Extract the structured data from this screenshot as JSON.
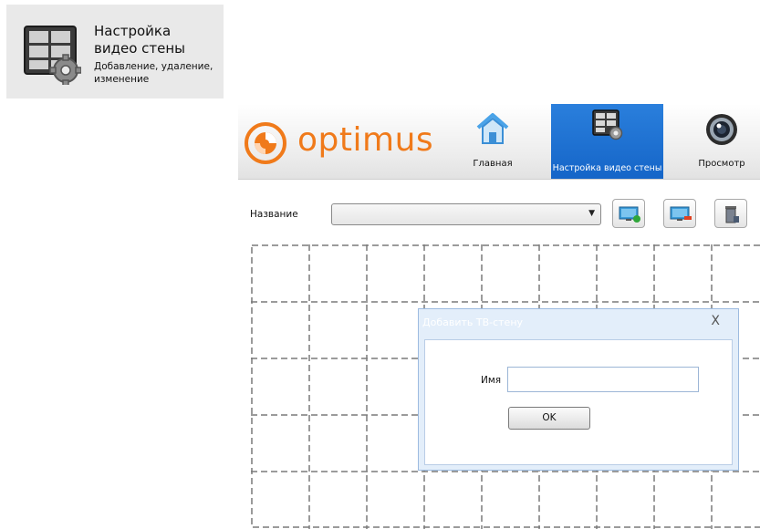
{
  "tile": {
    "title": "Настройка\nвидео стены",
    "description": "Добавление, удаление, изменение"
  },
  "logo": {
    "text": "optimus",
    "color": "#f07a1a"
  },
  "nav": {
    "items": [
      {
        "label": "Главная",
        "icon": "home-icon"
      },
      {
        "label": "Настройка видео стены",
        "icon": "video-wall-settings-icon",
        "active": true
      },
      {
        "label": "Просмотр",
        "icon": "camera-icon"
      }
    ],
    "active_color": "#1a6fd4"
  },
  "toolbar": {
    "name_label": "Название",
    "select_value": "",
    "buttons": [
      {
        "icon": "add-monitor-icon"
      },
      {
        "icon": "remove-monitor-icon"
      },
      {
        "icon": "trash-icon"
      }
    ]
  },
  "dialog": {
    "title": "Добавить ТВ-стену",
    "close": "X",
    "field_label": "Имя",
    "field_value": "",
    "ok_label": "OK"
  }
}
